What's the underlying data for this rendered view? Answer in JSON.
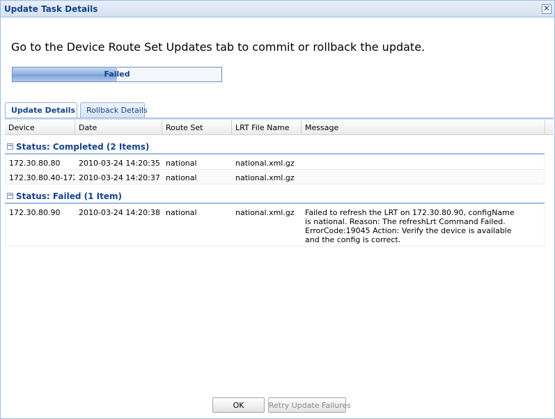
{
  "window": {
    "title": "Update Task Details",
    "close_symbol": "✕"
  },
  "instruction": "Go to the Device Route Set Updates tab to commit or rollback the update.",
  "progress": {
    "label": "Failed",
    "fraction": 0.5
  },
  "tabs": [
    {
      "label": "Update Details",
      "active": true
    },
    {
      "label": "Rollback Details",
      "active": false
    }
  ],
  "grid": {
    "columns": [
      "Device",
      "Date",
      "Route Set",
      "LRT File Name",
      "Message"
    ],
    "groups": [
      {
        "title": "Status: Completed (2 Items)",
        "rows": [
          {
            "device": "172.30.80.80",
            "date": "2010-03-24 14:20:35",
            "route_set": "national",
            "lrt": "national.xml.gz",
            "message": ""
          },
          {
            "device": "172.30.80.40-172.3",
            "date": "2010-03-24 14:20:37",
            "route_set": "national",
            "lrt": "national.xml.gz",
            "message": ""
          }
        ]
      },
      {
        "title": "Status: Failed (1 Item)",
        "rows": [
          {
            "device": "172.30.80.90",
            "date": "2010-03-24 14:20:38",
            "route_set": "national",
            "lrt": "national.xml.gz",
            "message": "Failed to refresh the LRT on 172.30.80.90, configName is national. Reason:  The refreshLrt Command Failed. ErrorCode:19045 Action:  Verify the device is available and the config is correct."
          }
        ]
      }
    ]
  },
  "buttons": {
    "ok": "OK",
    "retry": "Retry Update Failures"
  },
  "colors": {
    "accent": "#15428b",
    "border": "#99bbe8"
  }
}
